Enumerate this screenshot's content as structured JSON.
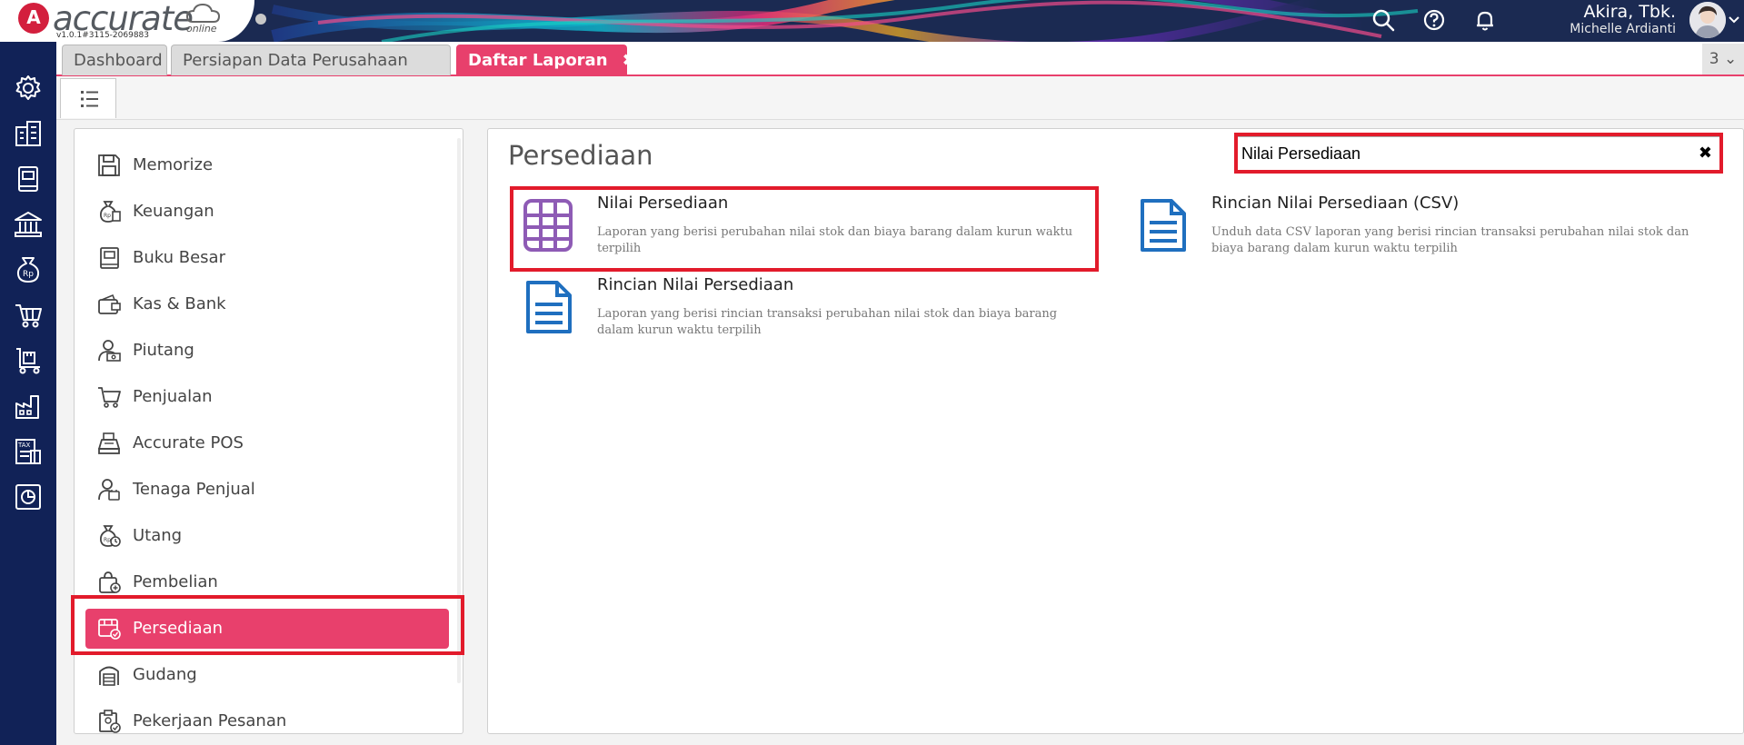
{
  "header": {
    "logo_mark": "A",
    "logo_text": "accurate",
    "logo_sub": "online",
    "version": "v1.0.1#3115-2069883",
    "company_name": "Akira, Tbk.",
    "user_name": "Michelle Ardianti"
  },
  "tabs": [
    {
      "label": "Dashboard"
    },
    {
      "label": "Persiapan Data Perusahaan"
    },
    {
      "label": "Daftar Laporan",
      "close": "✖"
    }
  ],
  "tab_count": "3 ⌄",
  "categories": [
    {
      "label": "Memorize",
      "icon": "floppy-icon"
    },
    {
      "label": "Keuangan",
      "icon": "money-bag-icon"
    },
    {
      "label": "Buku Besar",
      "icon": "ledger-icon"
    },
    {
      "label": "Kas & Bank",
      "icon": "wallet-icon"
    },
    {
      "label": "Piutang",
      "icon": "receivable-icon"
    },
    {
      "label": "Penjualan",
      "icon": "cart-icon"
    },
    {
      "label": "Accurate POS",
      "icon": "cash-register-icon"
    },
    {
      "label": "Tenaga Penjual",
      "icon": "salesperson-icon"
    },
    {
      "label": "Utang",
      "icon": "payable-icon"
    },
    {
      "label": "Pembelian",
      "icon": "purchase-bag-icon"
    },
    {
      "label": "Persediaan",
      "icon": "inventory-icon"
    },
    {
      "label": "Gudang",
      "icon": "warehouse-icon"
    },
    {
      "label": "Pekerjaan Pesanan",
      "icon": "job-order-icon"
    }
  ],
  "report_panel": {
    "title": "Persediaan",
    "search_value": "Nilai Persediaan",
    "search_clear": "✖"
  },
  "reports": [
    {
      "title": "Nilai Persediaan",
      "desc": "Laporan yang berisi perubahan nilai stok dan biaya barang dalam kurun waktu terpilih",
      "icon": "grid-table-icon"
    },
    {
      "title": "Rincian Nilai Persediaan (CSV)",
      "desc": "Unduh data CSV laporan yang berisi rincian transaksi perubahan nilai stok dan biaya barang dalam kurun waktu terpilih",
      "icon": "document-icon"
    },
    {
      "title": "Rincian Nilai Persediaan",
      "desc": "Laporan yang berisi rincian transaksi perubahan nilai stok dan biaya barang dalam kurun waktu terpilih",
      "icon": "document-icon"
    }
  ],
  "colors": {
    "navy": "#112257",
    "accent": "#e8406c",
    "highlight": "#e21b2b",
    "icon_purple": "#8e5bb5",
    "icon_blue": "#1f6fbf"
  }
}
